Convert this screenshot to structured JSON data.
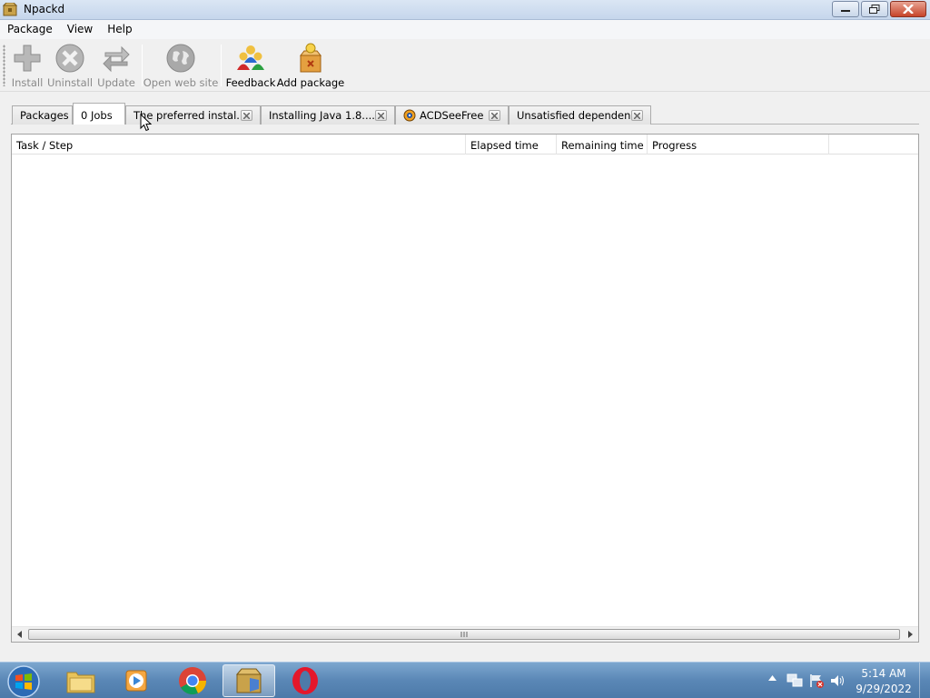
{
  "window": {
    "title": "Npackd"
  },
  "menu": [
    "Package",
    "View",
    "Help"
  ],
  "toolbar": {
    "install": "Install",
    "uninstall": "Uninstall",
    "update": "Update",
    "open_web_site": "Open web site",
    "feedback": "Feedback",
    "add_package": "Add package"
  },
  "tabs": [
    {
      "label": "Packages",
      "closable": false,
      "active": false
    },
    {
      "label": "0 Jobs",
      "closable": false,
      "active": true
    },
    {
      "label": "The preferred instal...",
      "closable": true,
      "active": false
    },
    {
      "label": "Installing Java 1.8....",
      "closable": true,
      "active": false
    },
    {
      "label": "ACDSeeFree",
      "closable": true,
      "active": false,
      "icon": "acdsee-icon"
    },
    {
      "label": "Unsatisfied dependen...",
      "closable": true,
      "active": false
    }
  ],
  "table": {
    "columns": [
      "Task / Step",
      "Elapsed time",
      "Remaining time",
      "Progress"
    ],
    "rows": []
  },
  "taskbar": {
    "apps": [
      "explorer-icon",
      "media-player-icon",
      "chrome-icon",
      "npackd-icon",
      "opera-icon"
    ],
    "clock_time": "5:14 AM",
    "clock_date": "9/29/2022"
  },
  "colors": {
    "accent": "#3a6ea5",
    "close_button": "#c7442a"
  }
}
